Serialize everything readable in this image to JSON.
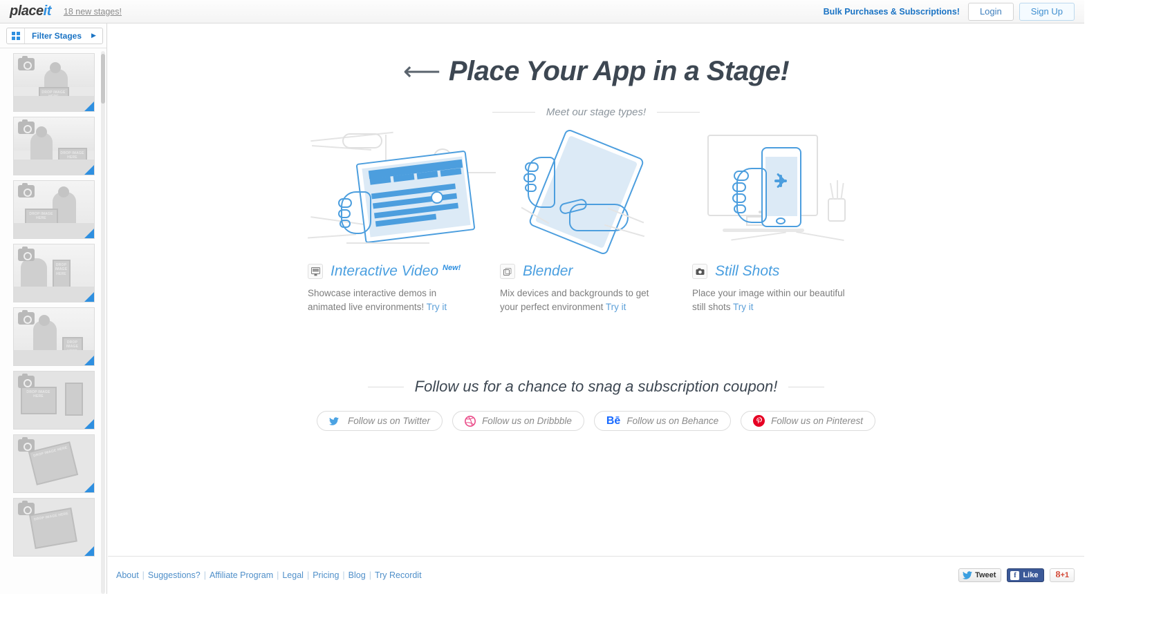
{
  "header": {
    "logo_main": "place",
    "logo_accent": "it",
    "new_stages_link": "18 new stages!",
    "bulk_link": "Bulk Purchases & Subscriptions!",
    "login_label": "Login",
    "signup_label": "Sign Up"
  },
  "sidebar": {
    "filter_label": "Filter Stages",
    "filter_arrow": "▶",
    "grid_icon": "grid-icon",
    "thumbnails": [
      {
        "name": "stage-thumb-1",
        "drop_text": "DROP IMAGE HERE"
      },
      {
        "name": "stage-thumb-2",
        "drop_text": "DROP IMAGE HERE"
      },
      {
        "name": "stage-thumb-3",
        "drop_text": "DROP IMAGE HERE"
      },
      {
        "name": "stage-thumb-4",
        "drop_text": "DROP IMAGE HERE"
      },
      {
        "name": "stage-thumb-5",
        "drop_text": "DROP IMAGE HERE"
      },
      {
        "name": "stage-thumb-6",
        "drop_text": "DROP IMAGE HERE"
      },
      {
        "name": "stage-thumb-7",
        "drop_text": "DROP IMAGE HERE"
      },
      {
        "name": "stage-thumb-8",
        "drop_text": "DROP IMAGE HERE"
      }
    ]
  },
  "main": {
    "hero_arrow": "⟵",
    "hero_title": "Place Your App in a Stage!",
    "stage_types_divider": "Meet our stage types!",
    "cards": [
      {
        "icon": "interactive-video-icon",
        "title": "Interactive Video",
        "badge": "New!",
        "desc_line1": "Showcase interactive demos in",
        "desc_line2": "animated live environments!",
        "try_label": "Try it"
      },
      {
        "icon": "blender-icon",
        "title": "Blender",
        "badge": "",
        "desc_line1": "Mix devices and backgrounds to get",
        "desc_line2": "your perfect environment",
        "try_label": "Try it"
      },
      {
        "icon": "still-shots-camera-icon",
        "title": "Still Shots",
        "badge": "",
        "desc_line1": "Place your image within our beautiful",
        "desc_line2": "still shots",
        "try_label": "Try it"
      }
    ],
    "social": {
      "heading": "Follow us for a chance to snag a subscription coupon!",
      "buttons": [
        {
          "icon": "twitter-icon",
          "label": "Follow us on Twitter",
          "color": "#4ba3e3"
        },
        {
          "icon": "dribbble-icon",
          "label": "Follow us on Dribbble",
          "color": "#ea4c89"
        },
        {
          "icon": "behance-icon",
          "label": "Follow us on Behance",
          "color": "#1769ff"
        },
        {
          "icon": "pinterest-icon",
          "label": "Follow us on Pinterest",
          "color": "#e60023"
        }
      ]
    }
  },
  "footer": {
    "links": [
      "About",
      "Suggestions?",
      "Affiliate Program",
      "Legal",
      "Pricing",
      "Blog",
      "Try Recordit"
    ],
    "separator": "|",
    "widgets": {
      "tweet_label": "Tweet",
      "like_label": "Like",
      "like_mark": "f",
      "gplus_label": "+1",
      "gplus_mark": "8"
    }
  },
  "colors": {
    "accent_blue": "#2e8fe0",
    "link_blue": "#1a73c4",
    "title_blue": "#4a9fe0",
    "text_gray": "#7d7d7d",
    "heading_dark": "#3d4752"
  }
}
